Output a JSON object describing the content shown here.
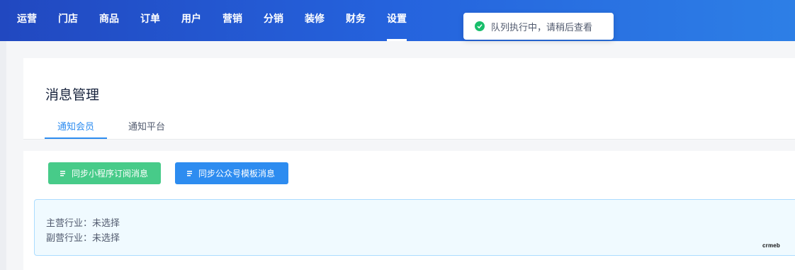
{
  "nav": {
    "items": [
      {
        "label": "运营"
      },
      {
        "label": "门店"
      },
      {
        "label": "商品"
      },
      {
        "label": "订单"
      },
      {
        "label": "用户"
      },
      {
        "label": "营销"
      },
      {
        "label": "分销"
      },
      {
        "label": "装修"
      },
      {
        "label": "财务"
      },
      {
        "label": "设置"
      }
    ],
    "active": "设置"
  },
  "toast": {
    "message": "队列执行中，请稍后查看",
    "status_color": "#19be6b"
  },
  "page": {
    "title": "消息管理",
    "tabs": [
      {
        "label": "通知会员"
      },
      {
        "label": "通知平台"
      }
    ],
    "active_tab": "通知会员"
  },
  "actions": {
    "sync_mini_program_label": "同步小程序订阅消息",
    "sync_official_account_label": "同步公众号模板消息"
  },
  "industry": {
    "primary": "主营行业：未选择",
    "secondary": "副营行业：未选择"
  },
  "logo_text": "crmeb",
  "colors": {
    "accent": "#2d8cf0",
    "success": "#47cb89",
    "topbar": "#2563dd"
  }
}
